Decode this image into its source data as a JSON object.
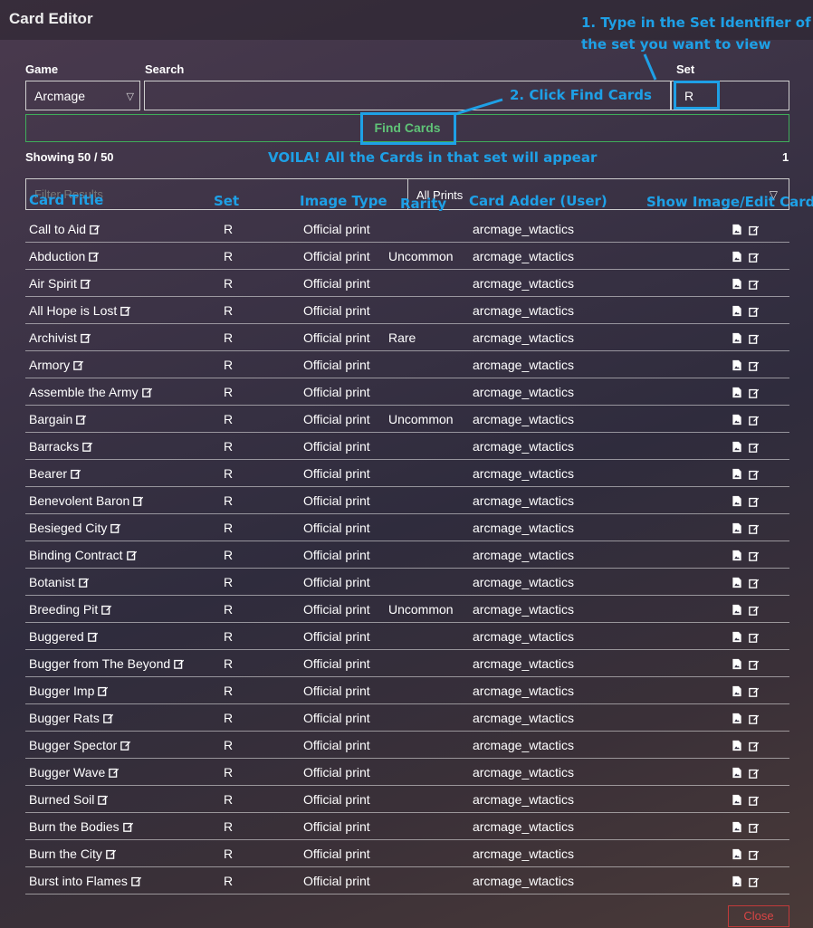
{
  "window": {
    "title": "Card Editor"
  },
  "form": {
    "game_label": "Game",
    "game_value": "Arcmage",
    "search_label": "Search",
    "search_value": "",
    "set_label": "Set",
    "set_value": "R",
    "find_button": "Find Cards"
  },
  "results": {
    "showing": "Showing 50 / 50",
    "page": "1",
    "filter_placeholder": "Filter Results",
    "prints_value": "All Prints"
  },
  "annotations": {
    "step1_line1": "1. Type in the Set Identifier of",
    "step1_line2": "the set you want to view",
    "step2": "2. Click Find Cards",
    "voila": "VOILA! All the Cards in that set will appear",
    "col_title": "Card Title",
    "col_set": "Set",
    "col_type": "Image Type",
    "col_rarity": "Rarity",
    "col_user": "Card Adder (User)",
    "col_actions": "Show Image/Edit Card"
  },
  "cards": [
    {
      "title": "Call to Aid",
      "set": "R",
      "type": "Official print",
      "rarity": "",
      "user": "arcmage_wtactics"
    },
    {
      "title": "Abduction",
      "set": "R",
      "type": "Official print",
      "rarity": "Uncommon",
      "user": "arcmage_wtactics"
    },
    {
      "title": "Air Spirit",
      "set": "R",
      "type": "Official print",
      "rarity": "",
      "user": "arcmage_wtactics"
    },
    {
      "title": "All Hope is Lost",
      "set": "R",
      "type": "Official print",
      "rarity": "",
      "user": "arcmage_wtactics"
    },
    {
      "title": "Archivist",
      "set": "R",
      "type": "Official print",
      "rarity": "Rare",
      "user": "arcmage_wtactics"
    },
    {
      "title": "Armory",
      "set": "R",
      "type": "Official print",
      "rarity": "",
      "user": "arcmage_wtactics"
    },
    {
      "title": "Assemble the Army",
      "set": "R",
      "type": "Official print",
      "rarity": "",
      "user": "arcmage_wtactics"
    },
    {
      "title": "Bargain",
      "set": "R",
      "type": "Official print",
      "rarity": "Uncommon",
      "user": "arcmage_wtactics"
    },
    {
      "title": "Barracks",
      "set": "R",
      "type": "Official print",
      "rarity": "",
      "user": "arcmage_wtactics"
    },
    {
      "title": "Bearer",
      "set": "R",
      "type": "Official print",
      "rarity": "",
      "user": "arcmage_wtactics"
    },
    {
      "title": "Benevolent Baron",
      "set": "R",
      "type": "Official print",
      "rarity": "",
      "user": "arcmage_wtactics"
    },
    {
      "title": "Besieged City",
      "set": "R",
      "type": "Official print",
      "rarity": "",
      "user": "arcmage_wtactics"
    },
    {
      "title": "Binding Contract",
      "set": "R",
      "type": "Official print",
      "rarity": "",
      "user": "arcmage_wtactics"
    },
    {
      "title": "Botanist",
      "set": "R",
      "type": "Official print",
      "rarity": "",
      "user": "arcmage_wtactics"
    },
    {
      "title": "Breeding Pit",
      "set": "R",
      "type": "Official print",
      "rarity": "Uncommon",
      "user": "arcmage_wtactics"
    },
    {
      "title": "Buggered",
      "set": "R",
      "type": "Official print",
      "rarity": "",
      "user": "arcmage_wtactics"
    },
    {
      "title": "Bugger from The Beyond",
      "set": "R",
      "type": "Official print",
      "rarity": "",
      "user": "arcmage_wtactics"
    },
    {
      "title": "Bugger Imp",
      "set": "R",
      "type": "Official print",
      "rarity": "",
      "user": "arcmage_wtactics"
    },
    {
      "title": "Bugger Rats",
      "set": "R",
      "type": "Official print",
      "rarity": "",
      "user": "arcmage_wtactics"
    },
    {
      "title": "Bugger Spector",
      "set": "R",
      "type": "Official print",
      "rarity": "",
      "user": "arcmage_wtactics"
    },
    {
      "title": "Bugger Wave",
      "set": "R",
      "type": "Official print",
      "rarity": "",
      "user": "arcmage_wtactics"
    },
    {
      "title": "Burned Soil",
      "set": "R",
      "type": "Official print",
      "rarity": "",
      "user": "arcmage_wtactics"
    },
    {
      "title": "Burn the Bodies",
      "set": "R",
      "type": "Official print",
      "rarity": "",
      "user": "arcmage_wtactics"
    },
    {
      "title": "Burn the City",
      "set": "R",
      "type": "Official print",
      "rarity": "",
      "user": "arcmage_wtactics"
    },
    {
      "title": "Burst into Flames",
      "set": "R",
      "type": "Official print",
      "rarity": "",
      "user": "arcmage_wtactics"
    }
  ],
  "footer": {
    "close_button": "Close"
  },
  "colors": {
    "annotation": "#1ea0e6",
    "find": "#5fc377",
    "close": "#d84545"
  }
}
